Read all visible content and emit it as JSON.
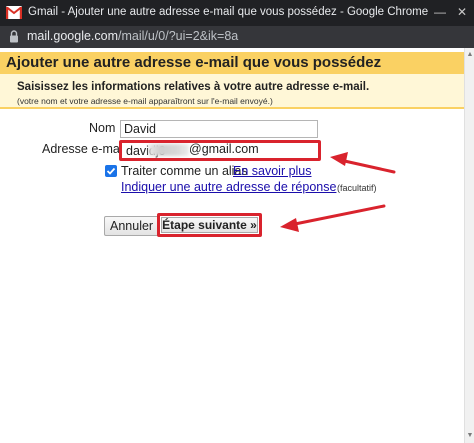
{
  "window": {
    "title": "Gmail - Ajouter une autre adresse e-mail que vous possédez - Google Chrome",
    "minimize_glyph": "—",
    "close_glyph": "✕"
  },
  "address_bar": {
    "host": "mail.google.com",
    "path": "/mail/u/0/?ui=2&ik=8a"
  },
  "page": {
    "header": "Ajouter une autre adresse e-mail que vous possédez",
    "intro": "Saisissez les informations relatives à votre autre adresse e-mail.",
    "subintro": "(votre nom et votre adresse e-mail apparaîtront sur l'e-mail envoyé.)"
  },
  "form": {
    "name_label": "Nom :",
    "name_value": "David",
    "email_label": "Adresse e-mail :",
    "email_prefix": "davidj0",
    "email_suffix": "@gmail.com",
    "alias_checked": true,
    "alias_label": "Traiter comme un alias",
    "learn_more_link": "En savoir plus",
    "reply_to_link": "Indiquer une autre adresse de réponse",
    "reply_to_note": "(facultatif)"
  },
  "buttons": {
    "cancel": "Annuler",
    "next": "Étape suivante »"
  },
  "colors": {
    "header_bg": "#fad163",
    "panel_bg": "#fff7d7",
    "highlight": "#d9232d",
    "link": "#1a0dab",
    "checkbox": "#1a73e8"
  },
  "icons": {
    "gmail": "gmail-icon",
    "lock": "lock-icon",
    "check": "check-icon"
  }
}
